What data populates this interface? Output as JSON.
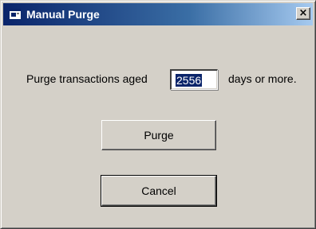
{
  "window": {
    "title": "Manual Purge",
    "close_glyph": "×",
    "title_icon": "app-window-icon"
  },
  "prompt": {
    "before_text": "Purge transactions aged",
    "days_value": "2556",
    "after_text": "days or more."
  },
  "buttons": {
    "purge_label": "Purge",
    "cancel_label": "Cancel"
  },
  "colors": {
    "titlebar_start": "#0a246a",
    "titlebar_end": "#a6caf0",
    "face": "#d4d0c8",
    "selection": "#0a246a"
  }
}
